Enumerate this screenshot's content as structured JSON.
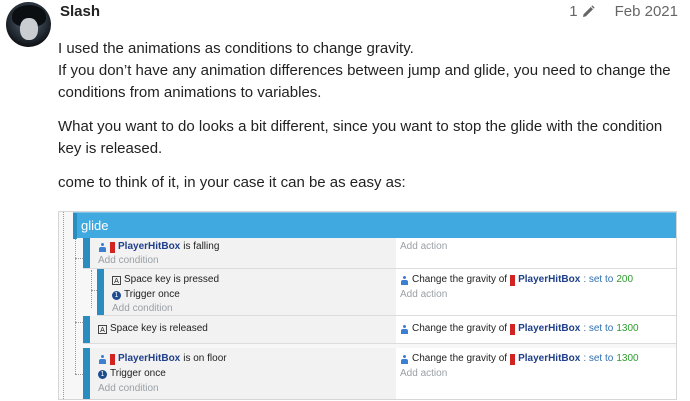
{
  "post": {
    "username": "Slash",
    "edit_count": "1",
    "date": "Feb 2021",
    "paragraphs": [
      "I used the animations as conditions to change gravity.",
      "If you don’t have any animation differences between jump and glide, you need to change the conditions from animations to variables.",
      "What you want to do looks a bit different, since you want to stop the glide with the condition key is released.",
      "come to think of it, in your case it can be as easy as:"
    ]
  },
  "sheet": {
    "group_title": "glide",
    "add_condition": "Add condition",
    "add_action": "Add action",
    "ev1": {
      "object": "PlayerHitBox",
      "cond_text": "is falling"
    },
    "ev1a": {
      "key_text": "Space key is pressed",
      "trigger_text": "Trigger once",
      "action_prefix": "Change the gravity of",
      "object": "PlayerHitBox",
      "set_text": ": set to",
      "value": "200"
    },
    "ev2": {
      "key_text": "Space key is released",
      "action_prefix": "Change the gravity of",
      "object": "PlayerHitBox",
      "set_text": ": set to",
      "value": "1300"
    },
    "ev3": {
      "object": "PlayerHitBox",
      "cond_text": "is on floor",
      "trigger_text": "Trigger once",
      "action_prefix": "Change the gravity of",
      "action_object": "PlayerHitBox",
      "set_text": ": set to",
      "value": "1300"
    }
  }
}
